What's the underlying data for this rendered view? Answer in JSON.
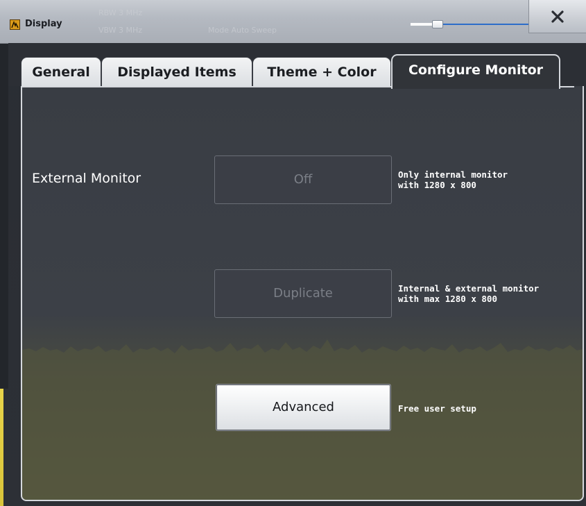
{
  "window": {
    "title": "Display",
    "background_ghost_text": [
      "RBW 3 MHz",
      "VBW 3 MHz",
      "Mode Auto Sweep"
    ],
    "transparency_slider_level": 0.2
  },
  "tabs": [
    {
      "label": "General",
      "active": false
    },
    {
      "label": "Displayed Items",
      "active": false
    },
    {
      "label": "Theme + Color",
      "active": false
    },
    {
      "label": "Configure Monitor",
      "active": true
    }
  ],
  "configure_monitor": {
    "section_label": "External Monitor",
    "options": [
      {
        "button": "Off",
        "description": [
          "Only internal monitor",
          "with 1280 x 800"
        ],
        "enabled": false
      },
      {
        "button": "Duplicate",
        "description": [
          "Internal & external monitor",
          "with max 1280 x 800"
        ],
        "enabled": false
      },
      {
        "button": "Advanced",
        "description": [
          "Free user setup"
        ],
        "enabled": true
      }
    ]
  },
  "colors": {
    "accent_blue": "#2d6dc9",
    "icon_orange": "#d99a1a",
    "panel_bg": "#3a3e45",
    "disabled_text": "#7b7f87"
  },
  "icons": {
    "window_icon": "analyzer-app-icon",
    "close": "close-icon"
  }
}
